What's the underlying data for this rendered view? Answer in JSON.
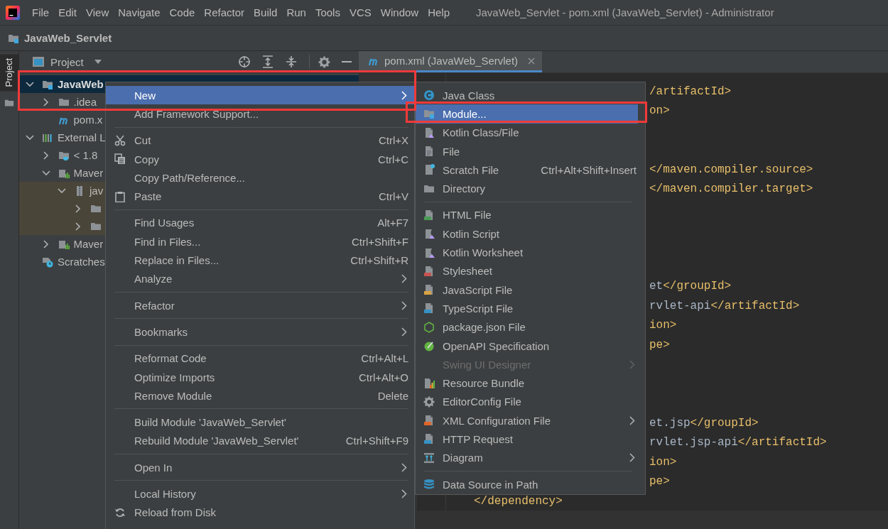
{
  "menu_bar": {
    "items": [
      "File",
      "Edit",
      "View",
      "Navigate",
      "Code",
      "Refactor",
      "Build",
      "Run",
      "Tools",
      "VCS",
      "Window",
      "Help"
    ]
  },
  "window": {
    "title": "JavaWeb_Servlet - pom.xml (JavaWeb_Servlet) - Administrator"
  },
  "nav_bar": {
    "project": "JavaWeb_Servlet"
  },
  "tool_stripe": {
    "tab": "Project"
  },
  "project_panel": {
    "title": "Project",
    "tree": [
      {
        "label": "JavaWeb",
        "kind": "module",
        "expanded": true,
        "selected": true,
        "highlighted": false,
        "children": [
          {
            "label": ".idea",
            "kind": "folder",
            "expanded": false,
            "selected": false,
            "highlighted": false
          },
          {
            "label": "pom.x",
            "kind": "maven",
            "selected": false,
            "highlighted": false
          }
        ]
      },
      {
        "label": "External L",
        "kind": "library",
        "expanded": true,
        "selected": false,
        "highlighted": false,
        "children": [
          {
            "label": "< 1.8",
            "kind": "jdk",
            "expanded": false,
            "selected": false,
            "highlighted": false
          },
          {
            "label": "Maver",
            "kind": "maven-lib",
            "expanded": true,
            "selected": false,
            "highlighted": false,
            "children": [
              {
                "label": "jav",
                "kind": "jar",
                "expanded": true,
                "selected": false,
                "highlighted": true,
                "children": [
                  {
                    "kind": "folder",
                    "expanded": false,
                    "selected": false,
                    "highlighted": true
                  },
                  {
                    "kind": "folder",
                    "expanded": false,
                    "selected": false,
                    "highlighted": true
                  }
                ]
              }
            ]
          },
          {
            "label": "Maver",
            "kind": "maven-lib",
            "expanded": false,
            "selected": false,
            "highlighted": false
          }
        ]
      },
      {
        "label": "Scratches",
        "kind": "scratches",
        "selected": false,
        "highlighted": false
      }
    ]
  },
  "editor": {
    "tab": {
      "title": "pom.xml (JavaWeb_Servlet)"
    },
    "lines": [
      {
        "kind": "clipped",
        "segments": [
          {
            "kind": "tag",
            "text": "/artifactId>"
          }
        ]
      },
      {
        "kind": "clipped",
        "segments": [
          {
            "kind": "tag",
            "text": "on>"
          }
        ]
      },
      {
        "kind": "blank"
      },
      {
        "kind": "blank"
      },
      {
        "kind": "clipped",
        "segments": [
          {
            "kind": "tag",
            "text": "</maven.compiler.source>"
          }
        ]
      },
      {
        "kind": "clipped",
        "segments": [
          {
            "kind": "tag",
            "text": "</maven.compiler.target>"
          }
        ]
      },
      {
        "kind": "blank"
      },
      {
        "kind": "blank"
      },
      {
        "kind": "blank"
      },
      {
        "kind": "blank"
      },
      {
        "kind": "clipped",
        "segments": [
          {
            "kind": "text",
            "text": "et"
          },
          {
            "kind": "tag",
            "text": "</groupId>"
          }
        ]
      },
      {
        "kind": "clipped",
        "segments": [
          {
            "kind": "text",
            "text": "rvlet-api"
          },
          {
            "kind": "tag",
            "text": "</artifactId>"
          }
        ]
      },
      {
        "kind": "clipped",
        "segments": [
          {
            "kind": "tag",
            "text": "ion>"
          }
        ]
      },
      {
        "kind": "clipped",
        "segments": [
          {
            "kind": "tag",
            "text": "pe>"
          }
        ]
      },
      {
        "kind": "blank"
      },
      {
        "kind": "blank"
      },
      {
        "kind": "blank"
      },
      {
        "kind": "clipped",
        "segments": [
          {
            "kind": "text",
            "text": "et.jsp"
          },
          {
            "kind": "tag",
            "text": "</groupId>"
          }
        ]
      },
      {
        "kind": "clipped",
        "segments": [
          {
            "kind": "text",
            "text": "rvlet.jsp-api"
          },
          {
            "kind": "tag",
            "text": "</artifactId>"
          }
        ]
      },
      {
        "kind": "clipped",
        "segments": [
          {
            "kind": "tag",
            "text": "ion>"
          }
        ]
      },
      {
        "kind": "clipped",
        "segments": [
          {
            "kind": "tag",
            "text": "pe>"
          }
        ]
      },
      {
        "kind": "full",
        "segments": [
          {
            "kind": "tag",
            "text": "</dependency>"
          }
        ]
      },
      {
        "kind": "blank",
        "current": true
      }
    ]
  },
  "context_menu": {
    "groups": [
      [
        {
          "label": "New",
          "submenu": true,
          "selected": true
        },
        {
          "label": "Add Framework Support...",
          "submenu": false,
          "selected": false
        }
      ],
      [
        {
          "label": "Cut",
          "kind": "cut",
          "shortcut": "Ctrl+X",
          "submenu": false,
          "selected": false
        },
        {
          "label": "Copy",
          "kind": "copy",
          "shortcut": "Ctrl+C",
          "submenu": false,
          "selected": false
        },
        {
          "label": "Copy Path/Reference...",
          "submenu": false,
          "selected": false
        },
        {
          "label": "Paste",
          "kind": "paste",
          "shortcut": "Ctrl+V",
          "submenu": false,
          "selected": false
        }
      ],
      [
        {
          "label": "Find Usages",
          "shortcut": "Alt+F7",
          "submenu": false,
          "selected": false
        },
        {
          "label": "Find in Files...",
          "shortcut": "Ctrl+Shift+F",
          "submenu": false,
          "selected": false
        },
        {
          "label": "Replace in Files...",
          "shortcut": "Ctrl+Shift+R",
          "submenu": false,
          "selected": false
        },
        {
          "label": "Analyze",
          "submenu": true,
          "selected": false
        }
      ],
      [
        {
          "label": "Refactor",
          "submenu": true,
          "selected": false
        }
      ],
      [
        {
          "label": "Bookmarks",
          "submenu": true,
          "selected": false
        }
      ],
      [
        {
          "label": "Reformat Code",
          "shortcut": "Ctrl+Alt+L",
          "submenu": false,
          "selected": false
        },
        {
          "label": "Optimize Imports",
          "shortcut": "Ctrl+Alt+O",
          "submenu": false,
          "selected": false
        },
        {
          "label": "Remove Module",
          "shortcut": "Delete",
          "submenu": false,
          "selected": false
        }
      ],
      [
        {
          "label": "Build Module 'JavaWeb_Servlet'",
          "submenu": false,
          "selected": false
        },
        {
          "label": "Rebuild Module 'JavaWeb_Servlet'",
          "shortcut": "Ctrl+Shift+F9",
          "submenu": false,
          "selected": false
        }
      ],
      [
        {
          "label": "Open In",
          "submenu": true,
          "selected": false
        }
      ],
      [
        {
          "label": "Local History",
          "submenu": true,
          "selected": false
        },
        {
          "label": "Reload from Disk",
          "kind": "reload",
          "submenu": false,
          "selected": false
        }
      ]
    ]
  },
  "new_submenu": {
    "groups": [
      [
        {
          "label": "Java Class",
          "kind": "class",
          "submenu": false,
          "selected": false,
          "disabled": false
        },
        {
          "label": "Module...",
          "kind": "module",
          "submenu": false,
          "selected": true,
          "disabled": false
        },
        {
          "label": "Kotlin Class/File",
          "kind": "kotlin",
          "submenu": false,
          "selected": false,
          "disabled": false
        },
        {
          "label": "File",
          "kind": "file",
          "submenu": false,
          "selected": false,
          "disabled": false
        },
        {
          "label": "Scratch File",
          "kind": "scratch",
          "shortcut": "Ctrl+Alt+Shift+Insert",
          "submenu": false,
          "selected": false,
          "disabled": false
        },
        {
          "label": "Directory",
          "kind": "folder",
          "submenu": false,
          "selected": false,
          "disabled": false
        }
      ],
      [
        {
          "label": "HTML File",
          "kind": "html",
          "submenu": false,
          "selected": false,
          "disabled": false
        },
        {
          "label": "Kotlin Script",
          "kind": "kotlin-script",
          "submenu": false,
          "selected": false,
          "disabled": false
        },
        {
          "label": "Kotlin Worksheet",
          "kind": "kotlin-script",
          "submenu": false,
          "selected": false,
          "disabled": false
        },
        {
          "label": "Stylesheet",
          "kind": "css",
          "submenu": false,
          "selected": false,
          "disabled": false
        },
        {
          "label": "JavaScript File",
          "kind": "js",
          "submenu": false,
          "selected": false,
          "disabled": false
        },
        {
          "label": "TypeScript File",
          "kind": "ts",
          "submenu": false,
          "selected": false,
          "disabled": false
        },
        {
          "label": "package.json File",
          "kind": "node",
          "submenu": false,
          "selected": false,
          "disabled": false
        },
        {
          "label": "OpenAPI Specification",
          "kind": "openapi",
          "submenu": false,
          "selected": false,
          "disabled": false
        },
        {
          "label": "Swing UI Designer",
          "submenu": true,
          "selected": false,
          "disabled": true
        },
        {
          "label": "Resource Bundle",
          "kind": "bundle",
          "submenu": false,
          "selected": false,
          "disabled": false
        },
        {
          "label": "EditorConfig File",
          "kind": "gear",
          "submenu": false,
          "selected": false,
          "disabled": false
        },
        {
          "label": "XML Configuration File",
          "kind": "xml",
          "submenu": true,
          "selected": false,
          "disabled": false
        },
        {
          "label": "HTTP Request",
          "kind": "api",
          "submenu": false,
          "selected": false,
          "disabled": false
        },
        {
          "label": "Diagram",
          "kind": "diagram",
          "submenu": true,
          "selected": false,
          "disabled": false
        }
      ],
      [
        {
          "label": "Data Source in Path",
          "kind": "database",
          "submenu": false,
          "selected": false,
          "disabled": false
        }
      ]
    ]
  },
  "annotations": [
    {
      "kind": "box"
    },
    {
      "kind": "box"
    }
  ]
}
